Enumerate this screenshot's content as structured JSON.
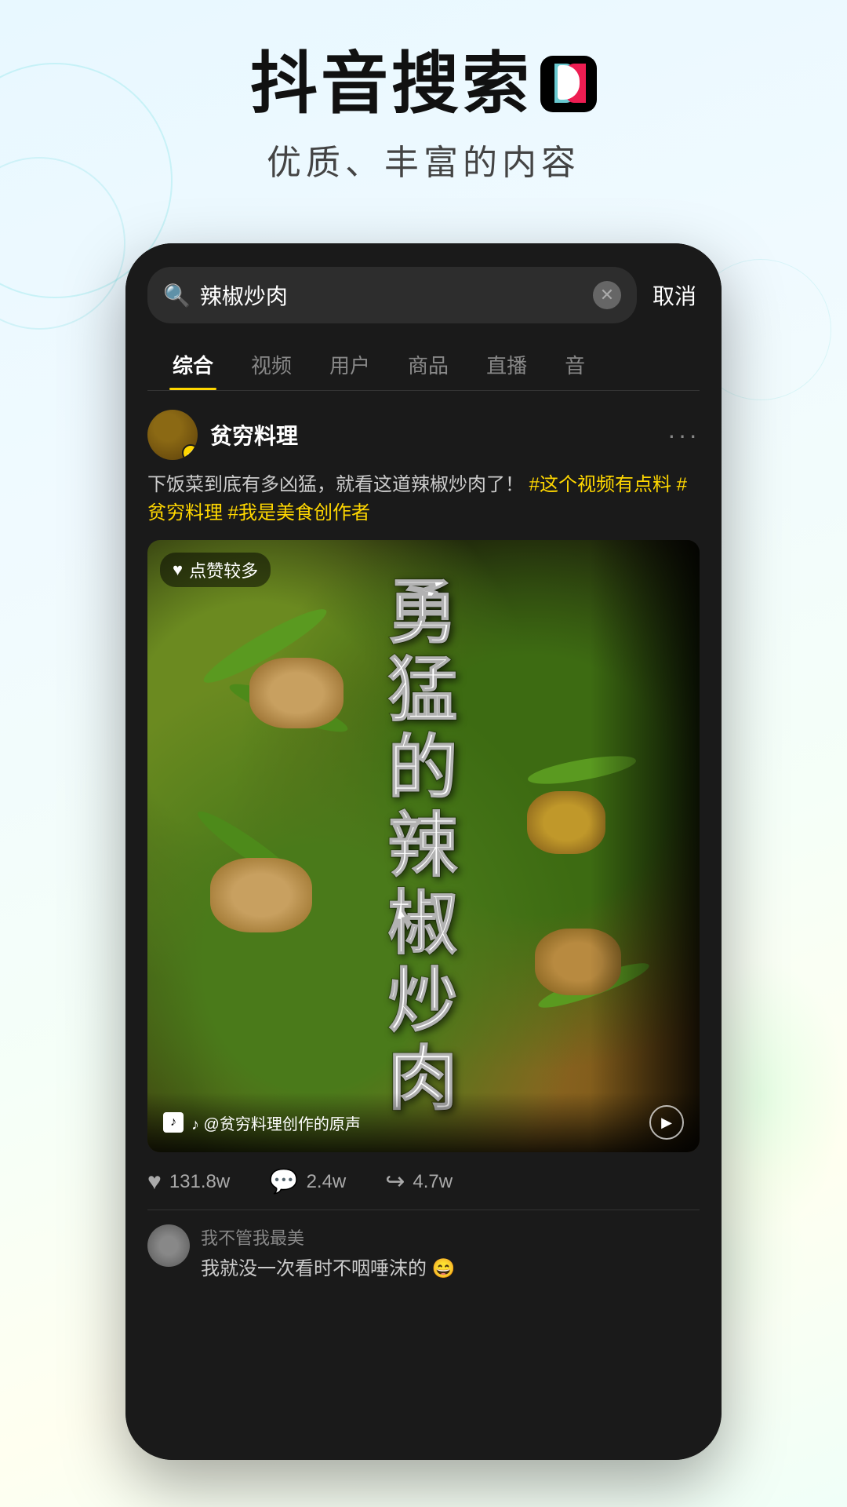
{
  "header": {
    "main_title": "抖音搜索",
    "subtitle": "优质、丰富的内容",
    "tiktok_logo_alt": "tiktok-logo"
  },
  "phone": {
    "search": {
      "query": "辣椒炒肉",
      "placeholder": "辣椒炒肉",
      "cancel_label": "取消"
    },
    "tabs": [
      {
        "label": "综合",
        "active": true
      },
      {
        "label": "视频",
        "active": false
      },
      {
        "label": "用户",
        "active": false
      },
      {
        "label": "商品",
        "active": false
      },
      {
        "label": "直播",
        "active": false
      },
      {
        "label": "音",
        "active": false
      }
    ],
    "result": {
      "user": {
        "name": "贫穷料理",
        "verified": true
      },
      "description_normal": "下饭菜到底有多凶猛，就看这道辣椒炒肉了！",
      "description_highlight": "#这个视频有点料 #贫穷料理 #我是美食创作者",
      "video": {
        "likes_badge": "点赞较多",
        "overlay_text": "勇猛的辣椒炒肉",
        "sound_text": "♪ @贫穷料理创作的原声"
      },
      "stats": {
        "likes": "131.8w",
        "comments": "2.4w",
        "shares": "4.7w"
      },
      "comments": [
        {
          "name": "我不管我最美",
          "text": "我就没一次看时不咽唾沫的 😄"
        }
      ]
    }
  }
}
